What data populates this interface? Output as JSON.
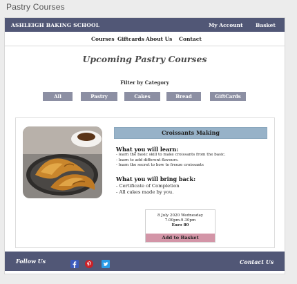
{
  "window": {
    "title": "Pastry Courses"
  },
  "header": {
    "brand": "ASHLEIGH BAKING SCHOOL",
    "my_account": "My Account",
    "basket": "Basket"
  },
  "nav": {
    "items": [
      "Courses",
      "Giftcards",
      "About Us",
      "Contact"
    ]
  },
  "main": {
    "title": "Upcoming Pastry Courses",
    "filter_label": "Filter by Category",
    "categories": [
      "All",
      "Pastry",
      "Cakes",
      "Bread",
      "GiftCards"
    ]
  },
  "course": {
    "title": "Croissants Making",
    "learn_title": "What you will learn:",
    "learn_items": [
      "- learn the basic skill to make croissants from the basic.",
      "- learn to add different flavours.",
      "- learn the secret to how to freeze croissants"
    ],
    "bring_title": "What you will bring back:",
    "bring_items": [
      "- Certificate of Completion",
      "- All cakes made by you."
    ],
    "session": {
      "date": "8 July 2020 Wednesday",
      "time": "7.00pm-9.30pm",
      "price": "Euro 80",
      "button": "Add to Basket"
    }
  },
  "footer": {
    "follow": "Follow Us",
    "contact": "Contact Us"
  },
  "colors": {
    "bar": "#515776",
    "filter_button": "#8c8fa3",
    "course_header": "#97b2c8",
    "basket_button": "#d395a7"
  }
}
